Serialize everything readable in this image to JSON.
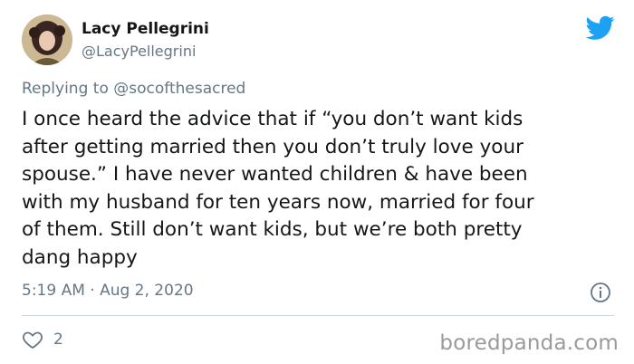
{
  "user": {
    "name": "Lacy Pellegrini",
    "handle": "@LacyPellegrini",
    "avatar_icon": "profile-photo"
  },
  "reply": {
    "prefix": "Replying to",
    "to": "@socofthesacred"
  },
  "tweet": {
    "lines": [
      "I once heard the advice that if “you don’t want kids",
      "after getting married then you don’t truly love your",
      "spouse.” I have never wanted children & have been",
      "with my husband for ten years now, married for four",
      "of them. Still don’t want kids, but we’re both pretty",
      "dang happy"
    ],
    "timestamp": "5:19 AM · Aug 2, 2020",
    "likes": "2"
  },
  "icons": {
    "brand": "twitter-bird-icon",
    "info": "info-icon",
    "like": "heart-icon"
  },
  "colors": {
    "brand": "#1da1f2",
    "secondary_text": "#657786",
    "divider": "#ccd6dd"
  },
  "watermark": "boredpanda.com"
}
